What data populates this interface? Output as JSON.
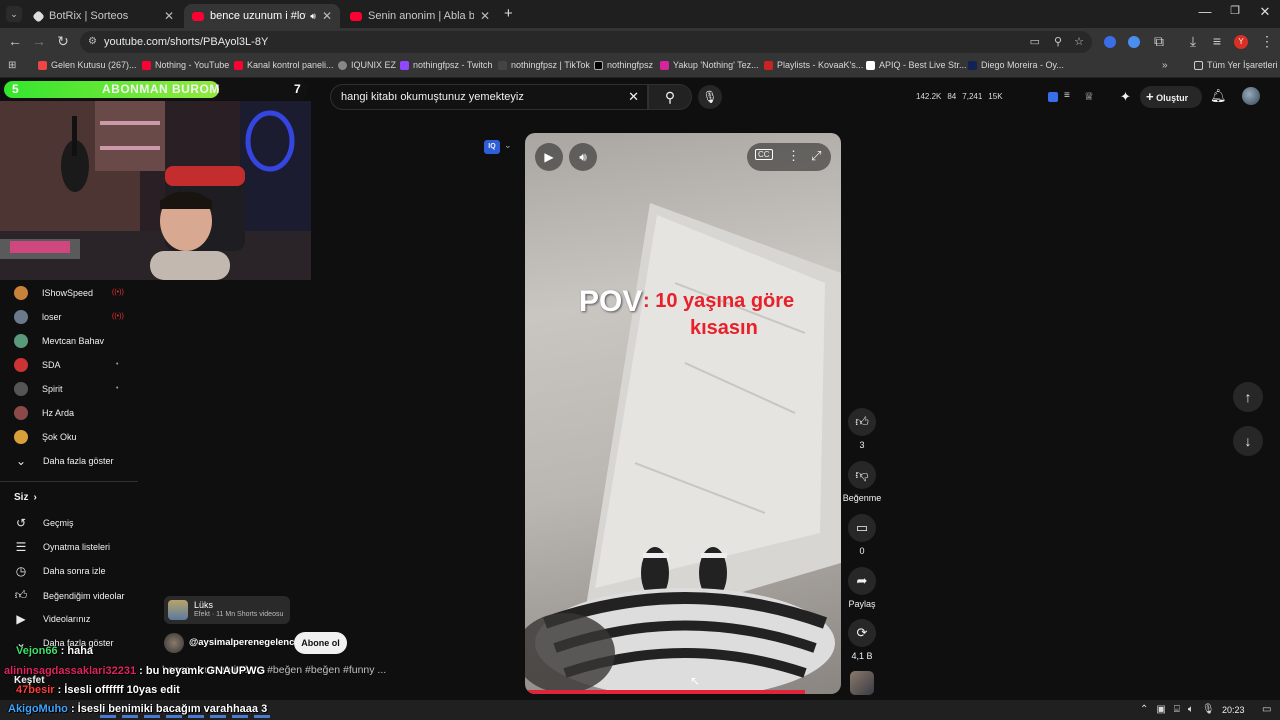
{
  "browser": {
    "tabs": [
      {
        "title": "BotRix | Sorteos",
        "color": "#e0e0e0"
      },
      {
        "title": "bence uzunum i #love #be",
        "color": "#ff0033"
      },
      {
        "title": "Senin anonim | Abla bu çok kü",
        "color": "#ff0033"
      }
    ],
    "url": "youtube.com/shorts/PBAyol3L-8Y",
    "bookmarks": [
      {
        "label": "Gelen Kutusu (267)...",
        "color": "#e44"
      },
      {
        "label": "Nothing - YouTube",
        "color": "#f03"
      },
      {
        "label": "Kanal kontrol paneli...",
        "color": "#f03"
      },
      {
        "label": "IQUNIX EZ",
        "color": "#888"
      },
      {
        "label": "nothingfpsz - Twitch",
        "color": "#9146ff"
      },
      {
        "label": "nothingfpsz | TikTok",
        "color": "#222"
      },
      {
        "label": "nothingfpsz",
        "color": "#111"
      },
      {
        "label": "Yakup 'Nothing' Tez...",
        "color": "#d6249f"
      },
      {
        "label": "Playlists - KovaaK's...",
        "color": "#c22"
      },
      {
        "label": "APIQ - Best Live Str...",
        "color": "#fff"
      },
      {
        "label": "Diego Moreira - Oy...",
        "color": "#125"
      }
    ],
    "all_bookmarks": "Tüm Yer İşaretleri"
  },
  "youtube": {
    "search_value": "hangi kitabı okumuştunuz yemekteyiz",
    "stats": [
      "142.2K",
      "84",
      "7,241",
      "15K"
    ],
    "create_label": "Oluştur",
    "subscriptions": [
      {
        "name": "IShowSpeed",
        "live": true,
        "color": "#c8823a"
      },
      {
        "name": "loser",
        "live": true,
        "color": "#6a7a8a"
      },
      {
        "name": "Mevtcan Bahav",
        "live": false,
        "color": "#5a9a7a"
      },
      {
        "name": "SDA",
        "live": false,
        "dot": true,
        "color": "#c33"
      },
      {
        "name": "Spirit",
        "live": false,
        "dot": true,
        "color": "#555"
      },
      {
        "name": "Hz Arda",
        "live": false,
        "color": "#8a4a4a"
      },
      {
        "name": "Şok Oku",
        "live": false,
        "color": "#d8a03a"
      }
    ],
    "show_more": "Daha fazla göster",
    "you_label": "Siz",
    "you_items": [
      "Geçmiş",
      "Oynatma listeleri",
      "Daha sonra izle",
      "Beğendiğim videolar",
      "Videolarınız",
      "Daha fazla göster"
    ],
    "explore": "Keşfet",
    "short": {
      "pov_word": "POV",
      "caption_line1": ": 10 yaşına göre",
      "caption_line2": "kısasın",
      "effect_title": "Lüks",
      "effect_sub": "Efekt · 11 Mn Shorts videosu",
      "channel": "@aysimalperenegelence",
      "subscribe": "Abone ol",
      "title_overlay": "bence uzunum i #love #beğen #beğen #funny ...",
      "likes": "3",
      "dislike_label": "Beğenme",
      "comments": "0",
      "share_label": "Paylaş",
      "remix_count": "4,1 B"
    }
  },
  "stream": {
    "sub_goal_label": "ABONMAN BUROM",
    "sub_goal_left": "5",
    "sub_goal_right": "7",
    "chat": [
      {
        "user": "Vejon66",
        "text": " : haha",
        "color": "#3ee06b"
      },
      {
        "user": "alininsagdassaklari32231",
        "text": " : bu neyamk GNAUPWG",
        "color": "#e0245e"
      },
      {
        "user": "47besir",
        "text": " : İsesli offffff 10yas edit",
        "color": "#ff3b3b"
      },
      {
        "user": "AkigoMuho",
        "text": " : İsesli benimiki bacağım varahhaaa 3",
        "color": "#3ea6ff"
      }
    ]
  },
  "taskbar": {
    "time": "20:23"
  }
}
